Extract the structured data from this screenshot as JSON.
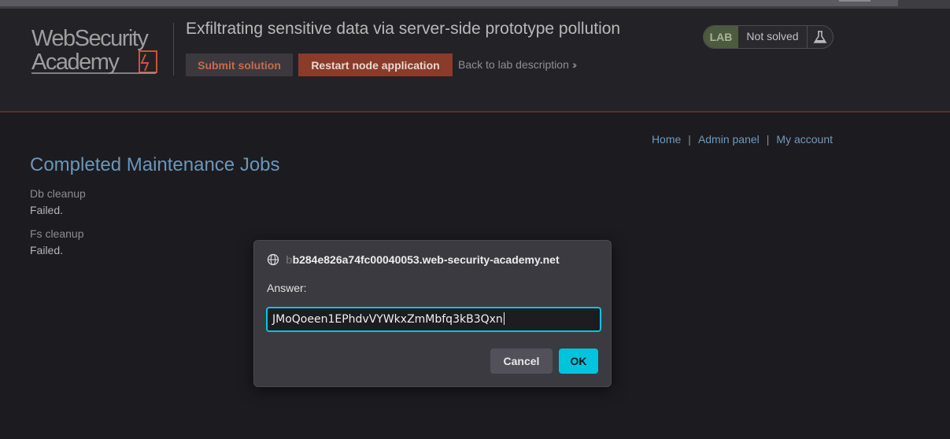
{
  "header": {
    "logo": {
      "line1": "WebSecurity",
      "line2": "Academy"
    },
    "lab_title": "Exfiltrating sensitive data via server-side prototype pollution",
    "submit_label": "Submit solution",
    "restart_label": "Restart node application",
    "back_label": "Back to lab description",
    "status": {
      "badge": "LAB",
      "state": "Not solved",
      "icon": "flask-icon"
    }
  },
  "nav": {
    "home": "Home",
    "admin": "Admin panel",
    "account": "My account",
    "separator": "|"
  },
  "main": {
    "heading": "Completed Maintenance Jobs",
    "jobs": [
      {
        "name": "Db cleanup",
        "status": "Failed."
      },
      {
        "name": "Fs cleanup",
        "status": "Failed."
      }
    ]
  },
  "dialog": {
    "origin_faded": "b",
    "origin": "b284e826a74fc00040053.web-security-academy.net",
    "label": "Answer:",
    "value": "JMoQoeen1EPhdvVYWkxZmMbfq3kB3Qxn",
    "cancel_label": "Cancel",
    "ok_label": "OK"
  },
  "colors": {
    "background": "#1c1b1f",
    "header_bg": "#232226",
    "accent_orange": "#c96a4e",
    "restart_bg": "#8a3b2a",
    "link_blue": "#6e9bbe",
    "heading_blue": "#6a96ba",
    "lab_green": "#4c5a3e",
    "focus_cyan": "#00c8e0",
    "ok_cyan": "#00c4dc"
  }
}
